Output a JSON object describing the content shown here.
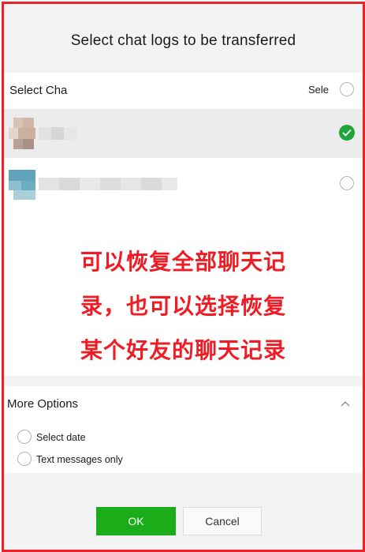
{
  "dialog": {
    "title": "Select chat logs to be transferred"
  },
  "chat_list": {
    "header_label": "Select Cha",
    "select_all_label": "Sele",
    "rows": [
      {
        "selected": true
      },
      {
        "selected": false
      }
    ]
  },
  "annotation": {
    "line1": "可以恢复全部聊天记",
    "line2": "录，也可以选择恢复",
    "line3": "某个好友的聊天记录"
  },
  "more_options": {
    "title": "More Options",
    "items": [
      {
        "label": "Select date"
      },
      {
        "label": "Text messages only"
      }
    ]
  },
  "buttons": {
    "ok_label": "OK",
    "cancel_label": "Cancel"
  },
  "colors": {
    "accent_green": "#1aad19",
    "check_green": "#20a53a",
    "annotation_red": "#ee1c24",
    "frame_red": "#e8242a"
  }
}
